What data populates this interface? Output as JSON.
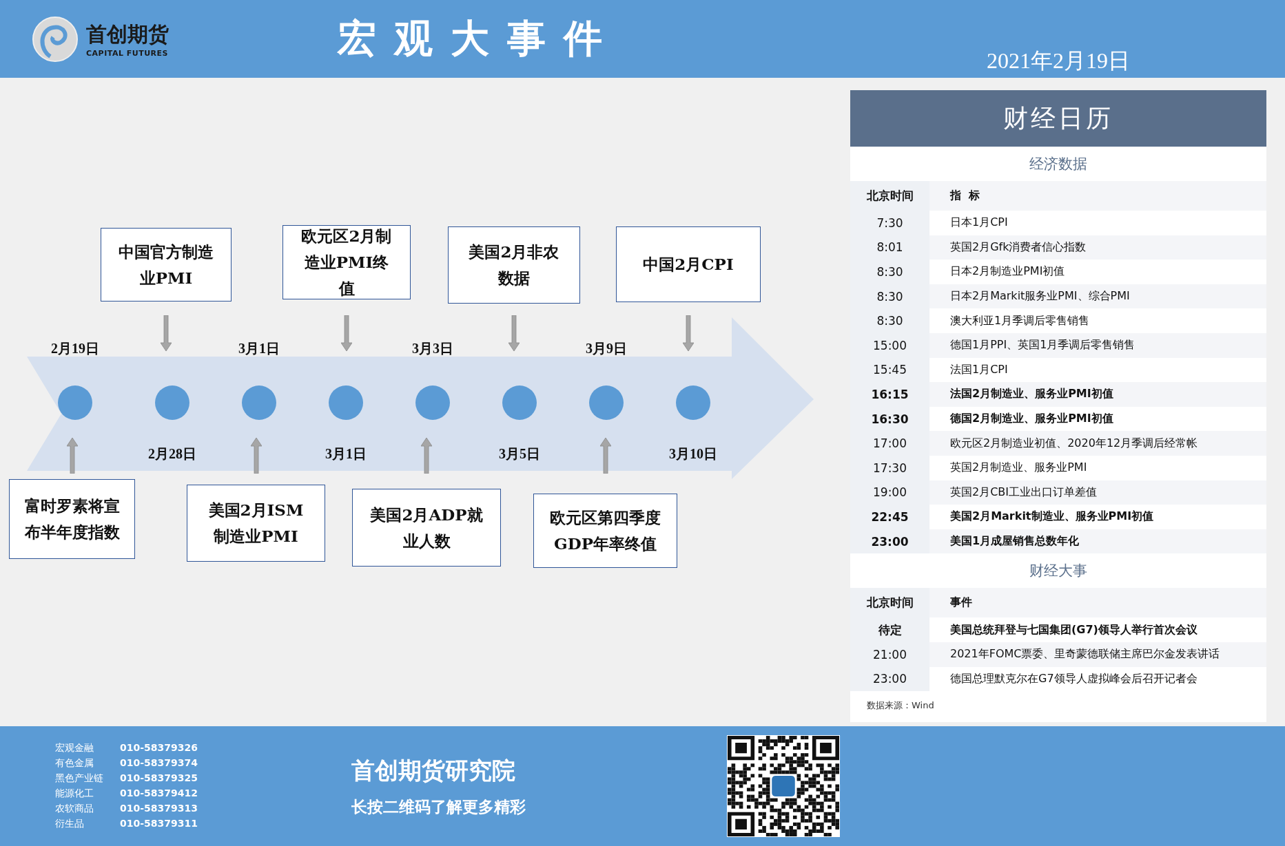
{
  "header": {
    "brand_name": "首创期货",
    "brand_subtitle": "CAPITAL FUTURES",
    "title": "宏观大事件",
    "date": "2021年2月19日"
  },
  "timeline": {
    "events": [
      {
        "date": "2月19日",
        "text": "富时罗素将宣布半年度指数",
        "kind": "below"
      },
      {
        "date": "2月28日",
        "text": "中国官方制造业PMI",
        "kind": "above"
      },
      {
        "date": "3月1日",
        "text": "美国2月ISM制造业PMI",
        "kind": "below"
      },
      {
        "date": "3月1日",
        "text": "欧元区2月制造业PMI终值",
        "kind": "above"
      },
      {
        "date": "3月3日",
        "text": "美国2月ADP就业人数",
        "kind": "below"
      },
      {
        "date": "3月5日",
        "text": "美国2月非农数据",
        "kind": "above"
      },
      {
        "date": "3月9日",
        "text": "欧元区第四季度GDP年率终值",
        "kind": "below"
      },
      {
        "date": "3月10日",
        "text": "中国2月CPI",
        "kind": "above"
      }
    ]
  },
  "calendar": {
    "title": "财经日历",
    "sections": [
      {
        "heading": "经济数据",
        "columns": [
          "北京时间",
          "指  标"
        ],
        "rows": [
          {
            "time": "7:30",
            "text": "日本1月CPI",
            "bold": false
          },
          {
            "time": "8:01",
            "text": "英国2月Gfk消费者信心指数",
            "bold": false
          },
          {
            "time": "8:30",
            "text": "日本2月制造业PMI初值",
            "bold": false
          },
          {
            "time": "8:30",
            "text": "日本2月Markit服务业PMI、综合PMI",
            "bold": false
          },
          {
            "time": "8:30",
            "text": "澳大利亚1月季调后零售销售",
            "bold": false
          },
          {
            "time": "15:00",
            "text": "德国1月PPI、英国1月季调后零售销售",
            "bold": false
          },
          {
            "time": "15:45",
            "text": "法国1月CPI",
            "bold": false
          },
          {
            "time": "16:15",
            "text": "法国2月制造业、服务业PMI初值",
            "bold": true
          },
          {
            "time": "16:30",
            "text": "德国2月制造业、服务业PMI初值",
            "bold": true
          },
          {
            "time": "17:00",
            "text": "欧元区2月制造业初值、2020年12月季调后经常帐",
            "bold": false
          },
          {
            "time": "17:30",
            "text": "英国2月制造业、服务业PMI",
            "bold": false
          },
          {
            "time": "19:00",
            "text": "英国2月CBI工业出口订单差值",
            "bold": false
          },
          {
            "time": "22:45",
            "text": "美国2月Markit制造业、服务业PMI初值",
            "bold": true
          },
          {
            "time": "23:00",
            "text": "美国1月成屋销售总数年化",
            "bold": true
          }
        ]
      },
      {
        "heading": "财经大事",
        "columns": [
          "北京时间",
          "事件"
        ],
        "rows": [
          {
            "time": "待定",
            "text": "美国总统拜登与七国集团(G7)领导人举行首次会议",
            "bold": true
          },
          {
            "time": "21:00",
            "text": "2021年FOMC票委、里奇蒙德联储主席巴尔金发表讲话",
            "bold": false
          },
          {
            "time": "23:00",
            "text": "德国总理默克尔在G7领导人虚拟峰会后召开记者会",
            "bold": false
          }
        ]
      }
    ],
    "source": "数据来源：Wind"
  },
  "footer": {
    "contacts": [
      {
        "dept": "宏观金融",
        "phone": "010-58379326"
      },
      {
        "dept": "有色金属",
        "phone": "010-58379374"
      },
      {
        "dept": "黑色产业链",
        "phone": "010-58379325"
      },
      {
        "dept": "能源化工",
        "phone": "010-58379412"
      },
      {
        "dept": "农软商品",
        "phone": "010-58379313"
      },
      {
        "dept": "衍生品",
        "phone": "010-58379311"
      }
    ],
    "institute": "首创期货研究院",
    "slogan": "长按二维码了解更多精彩"
  }
}
